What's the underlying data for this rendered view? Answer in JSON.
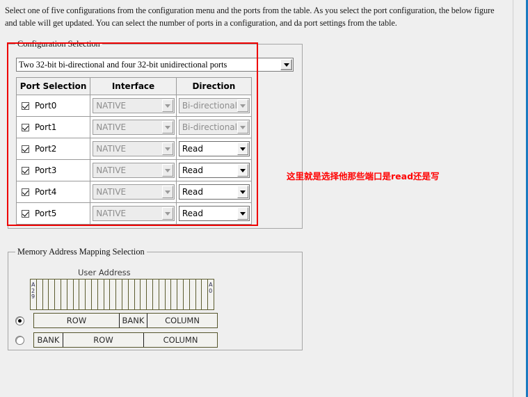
{
  "instructions": {
    "text": "Select one of five configurations from the configuration menu and the ports from the table. As you select the port configuration, the below figure and table will get updated. You can select the number of ports in a configuration, and da port settings from the table."
  },
  "annotation": {
    "text": "这里就是选择他那些端口是read还是写",
    "color": "#ff0000"
  },
  "config_group": {
    "title": "Configuration Selection",
    "combo": {
      "selected": "Two 32-bit bi-directional and four 32-bit unidirectional ports",
      "arrow_icon": "chevron-down-icon"
    },
    "table": {
      "headers": [
        "Port Selection",
        "Interface",
        "Direction"
      ],
      "rows": [
        {
          "port": "Port0",
          "checked": true,
          "interface": "NATIVE",
          "interface_enabled": false,
          "direction": "Bi-directional",
          "direction_enabled": false
        },
        {
          "port": "Port1",
          "checked": true,
          "interface": "NATIVE",
          "interface_enabled": false,
          "direction": "Bi-directional",
          "direction_enabled": false
        },
        {
          "port": "Port2",
          "checked": true,
          "interface": "NATIVE",
          "interface_enabled": false,
          "direction": "Read",
          "direction_enabled": true
        },
        {
          "port": "Port3",
          "checked": true,
          "interface": "NATIVE",
          "interface_enabled": false,
          "direction": "Read",
          "direction_enabled": true
        },
        {
          "port": "Port4",
          "checked": true,
          "interface": "NATIVE",
          "interface_enabled": false,
          "direction": "Read",
          "direction_enabled": true
        },
        {
          "port": "Port5",
          "checked": true,
          "interface": "NATIVE",
          "interface_enabled": false,
          "direction": "Read",
          "direction_enabled": true
        }
      ]
    }
  },
  "memory_group": {
    "title": "Memory Address Mapping Selection",
    "user_address_label": "User Address",
    "address_bits": {
      "count": 30,
      "msb_label": "A29",
      "lsb_label": "A0"
    },
    "mappings": [
      {
        "selected": true,
        "segments": [
          {
            "label": "ROW",
            "width": 123
          },
          {
            "label": "BANK",
            "width": 40
          },
          {
            "label": "COLUMN",
            "width": 100
          }
        ]
      },
      {
        "selected": false,
        "segments": [
          {
            "label": "BANK",
            "width": 42
          },
          {
            "label": "ROW",
            "width": 116
          },
          {
            "label": "COLUMN",
            "width": 105
          }
        ]
      }
    ]
  }
}
